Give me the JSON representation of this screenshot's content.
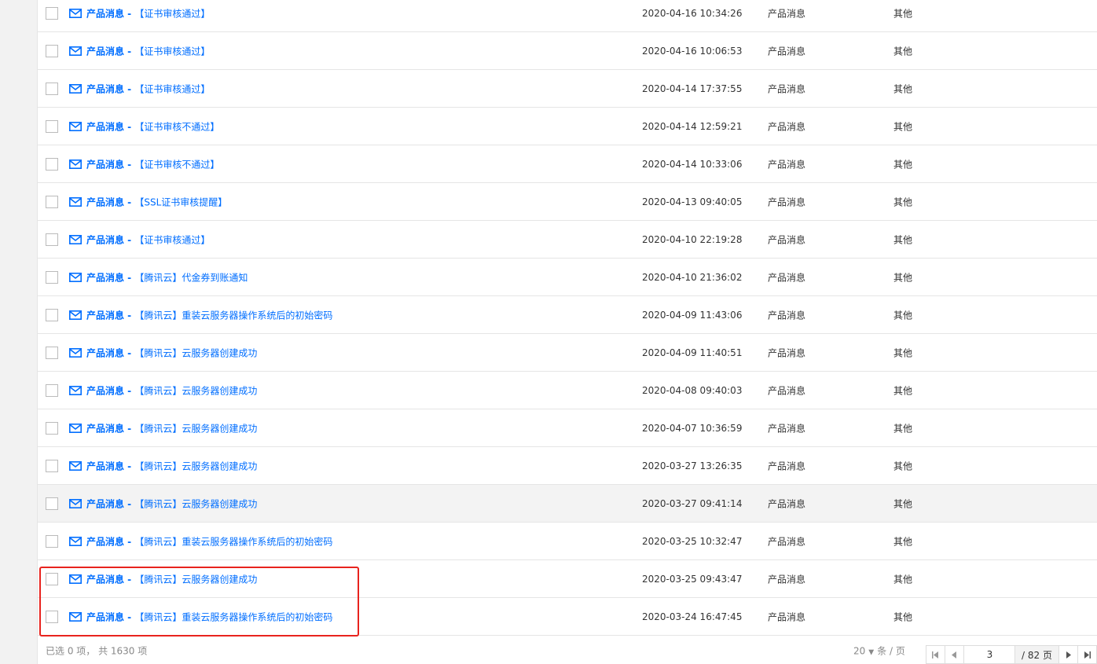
{
  "messages": [
    {
      "category": "产品消息 - ",
      "subject": "【证书审核通过】",
      "time": "2020-04-16 10:34:26",
      "type": "产品消息",
      "other": "其他"
    },
    {
      "category": "产品消息 - ",
      "subject": "【证书审核通过】",
      "time": "2020-04-16 10:06:53",
      "type": "产品消息",
      "other": "其他"
    },
    {
      "category": "产品消息 - ",
      "subject": "【证书审核通过】",
      "time": "2020-04-14 17:37:55",
      "type": "产品消息",
      "other": "其他"
    },
    {
      "category": "产品消息 - ",
      "subject": "【证书审核不通过】",
      "time": "2020-04-14 12:59:21",
      "type": "产品消息",
      "other": "其他"
    },
    {
      "category": "产品消息 - ",
      "subject": "【证书审核不通过】",
      "time": "2020-04-14 10:33:06",
      "type": "产品消息",
      "other": "其他"
    },
    {
      "category": "产品消息 - ",
      "subject": "【SSL证书审核提醒】",
      "time": "2020-04-13 09:40:05",
      "type": "产品消息",
      "other": "其他"
    },
    {
      "category": "产品消息 - ",
      "subject": "【证书审核通过】",
      "time": "2020-04-10 22:19:28",
      "type": "产品消息",
      "other": "其他"
    },
    {
      "category": "产品消息 - ",
      "subject": "【腾讯云】代金券到账通知",
      "time": "2020-04-10 21:36:02",
      "type": "产品消息",
      "other": "其他"
    },
    {
      "category": "产品消息 - ",
      "subject": "【腾讯云】重装云服务器操作系统后的初始密码",
      "time": "2020-04-09 11:43:06",
      "type": "产品消息",
      "other": "其他"
    },
    {
      "category": "产品消息 - ",
      "subject": "【腾讯云】云服务器创建成功",
      "time": "2020-04-09 11:40:51",
      "type": "产品消息",
      "other": "其他"
    },
    {
      "category": "产品消息 - ",
      "subject": "【腾讯云】云服务器创建成功",
      "time": "2020-04-08 09:40:03",
      "type": "产品消息",
      "other": "其他"
    },
    {
      "category": "产品消息 - ",
      "subject": "【腾讯云】云服务器创建成功",
      "time": "2020-04-07 10:36:59",
      "type": "产品消息",
      "other": "其他"
    },
    {
      "category": "产品消息 - ",
      "subject": "【腾讯云】云服务器创建成功",
      "time": "2020-03-27 13:26:35",
      "type": "产品消息",
      "other": "其他"
    },
    {
      "category": "产品消息 - ",
      "subject": "【腾讯云】云服务器创建成功",
      "time": "2020-03-27 09:41:14",
      "type": "产品消息",
      "other": "其他"
    },
    {
      "category": "产品消息 - ",
      "subject": "【腾讯云】重装云服务器操作系统后的初始密码",
      "time": "2020-03-25 10:32:47",
      "type": "产品消息",
      "other": "其他"
    },
    {
      "category": "产品消息 - ",
      "subject": "【腾讯云】云服务器创建成功",
      "time": "2020-03-25 09:43:47",
      "type": "产品消息",
      "other": "其他"
    },
    {
      "category": "产品消息 - ",
      "subject": "【腾讯云】重装云服务器操作系统后的初始密码",
      "time": "2020-03-24 16:47:45",
      "type": "产品消息",
      "other": "其他"
    }
  ],
  "hovered_row": 13,
  "footer": {
    "selection_info": "已选 0 项， 共 1630 项",
    "page_size": "20",
    "page_size_unit": "条 / 页",
    "current_page": "3",
    "total_pages": "/ 82 页"
  },
  "colors": {
    "link": "#006eff",
    "highlight_border": "#e8231e"
  },
  "icons": {
    "row_icon": "mail-icon",
    "first": "first-page-icon",
    "prev": "prev-page-icon",
    "next": "next-page-icon",
    "last": "last-page-icon",
    "page_size_caret": "caret-down-icon"
  }
}
